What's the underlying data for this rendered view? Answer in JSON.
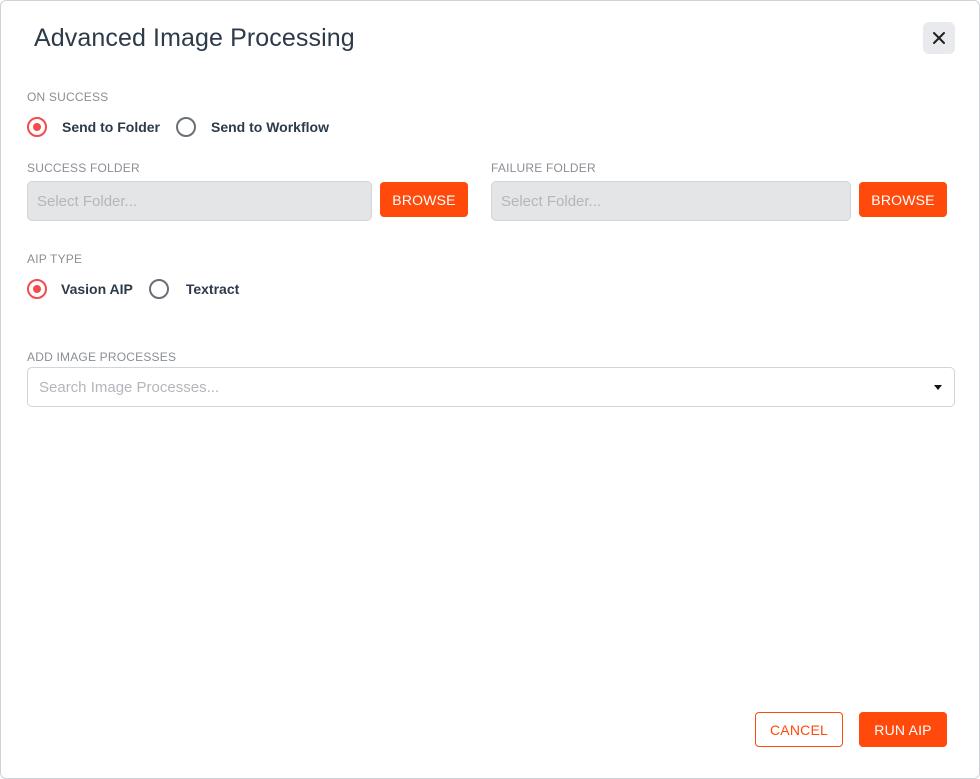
{
  "dialog": {
    "title": "Advanced Image Processing",
    "close_icon": "close-icon"
  },
  "on_success": {
    "label": "ON SUCCESS",
    "options": [
      {
        "label": "Send to Folder",
        "checked": true
      },
      {
        "label": "Send to Workflow",
        "checked": false
      }
    ]
  },
  "success_folder": {
    "label": "SUCCESS FOLDER",
    "placeholder": "Select Folder...",
    "browse_label": "BROWSE"
  },
  "failure_folder": {
    "label": "FAILURE FOLDER",
    "placeholder": "Select Folder...",
    "browse_label": "BROWSE"
  },
  "aip_type": {
    "label": "AIP TYPE",
    "options": [
      {
        "label": "Vasion AIP",
        "checked": true
      },
      {
        "label": "Textract",
        "checked": false
      }
    ]
  },
  "image_processes": {
    "label": "ADD IMAGE PROCESSES",
    "placeholder": "Search Image Processes...",
    "dropdown_icon": "caret-down-icon"
  },
  "footer": {
    "cancel_label": "CANCEL",
    "run_label": "RUN AIP"
  },
  "colors": {
    "accent": "#ff4a0b",
    "radio_checked": "#f44b4b",
    "title": "#2d3a4a"
  }
}
